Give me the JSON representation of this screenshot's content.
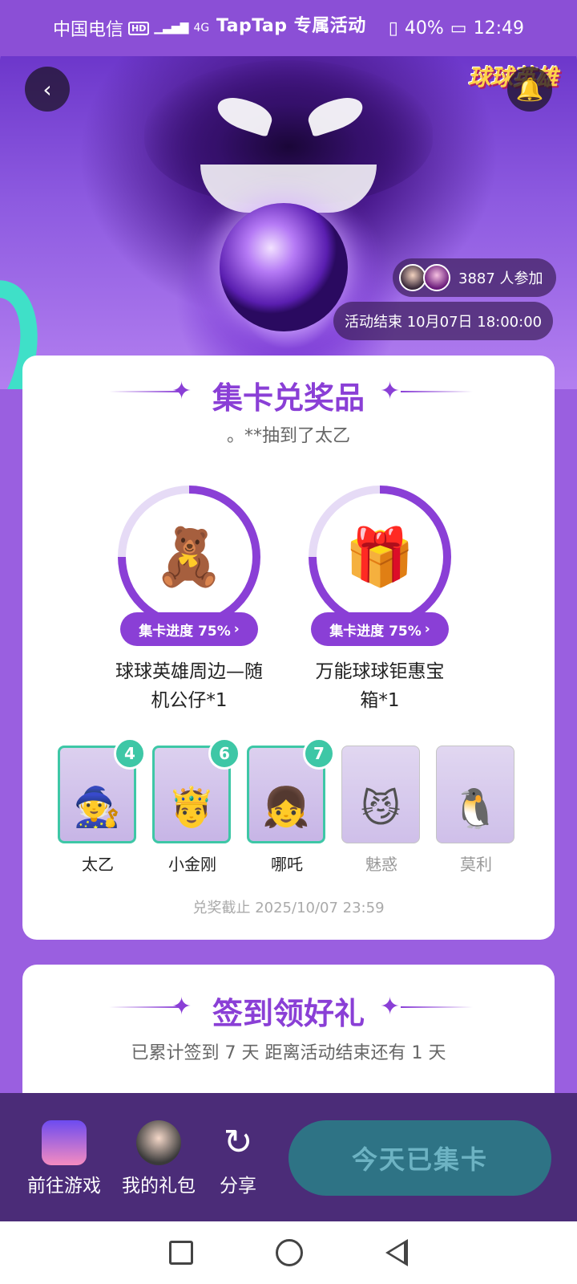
{
  "status_bar": {
    "carrier": "中国电信",
    "hd": "HD",
    "network": "4G",
    "brand_overlay": "TapTap 专属活动",
    "battery": "40%",
    "time": "12:49"
  },
  "hero": {
    "game_logo": "球球英雄",
    "participants_text": "3887 人参加",
    "end_time": "活动结束 10月07日 18:00:00"
  },
  "collect_section": {
    "title": "集卡兑奖品",
    "ticker": "。**抽到了太乙",
    "prizes": [
      {
        "progress_label": "集卡进度 75%",
        "progress": 0.75,
        "name_line1": "球球英雄周边—随",
        "name_line2": "机公仔*1",
        "icon": "figurine-icon"
      },
      {
        "progress_label": "集卡进度 75%",
        "progress": 0.75,
        "name_line1": "万能球球钜惠宝",
        "name_line2": "箱*1",
        "icon": "treasure-chest-icon"
      }
    ],
    "cards": [
      {
        "name": "太乙",
        "count": "4",
        "owned": true
      },
      {
        "name": "小金刚",
        "count": "6",
        "owned": true
      },
      {
        "name": "哪吒",
        "count": "7",
        "owned": true
      },
      {
        "name": "魅惑",
        "count": "",
        "owned": false
      },
      {
        "name": "莫利",
        "count": "",
        "owned": false
      }
    ],
    "deadline": "兑奖截止 2025/10/07 23:59"
  },
  "signin_section": {
    "title": "签到领好礼",
    "summary": "已累计签到 7 天  距离活动结束还有 1 天"
  },
  "bottom_bar": {
    "go_game": "前往游戏",
    "my_gifts": "我的礼包",
    "share": "分享",
    "main_button": "今天已集卡"
  },
  "colors": {
    "accent": "#8a3fd6",
    "owned_border": "#3ec7a6",
    "bottom_bar": "#4b2c78",
    "main_button": "#2e7385"
  }
}
